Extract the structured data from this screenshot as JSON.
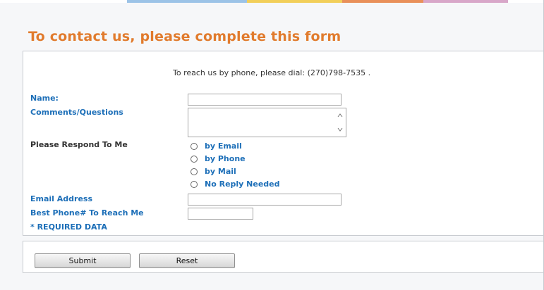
{
  "page": {
    "title": "To contact us, please complete this form",
    "phone_note": "To reach us by phone, please dial: (270)798-7535 ."
  },
  "form": {
    "name_label": "Name:",
    "comments_label": "Comments/Questions",
    "respond_label": "Please Respond To Me",
    "email_label": "Email Address",
    "phone_label": "Best Phone# To Reach Me",
    "required_note": "* REQUIRED DATA",
    "name_value": "",
    "comments_value": "",
    "email_value": "",
    "phone_value": "",
    "response_options": [
      "by Email",
      "by Phone",
      "by Mail",
      "No Reply Needed"
    ],
    "selected_response": ""
  },
  "buttons": {
    "submit_label": "Submit",
    "reset_label": "Reset"
  },
  "colors": {
    "title": "#e17b2d",
    "label_blue": "#1d6fb8",
    "label_dark": "#333333",
    "border": "#c9ccd1"
  },
  "icons": {
    "scroll_up": "scroll-up-icon",
    "scroll_down": "scroll-down-icon"
  }
}
